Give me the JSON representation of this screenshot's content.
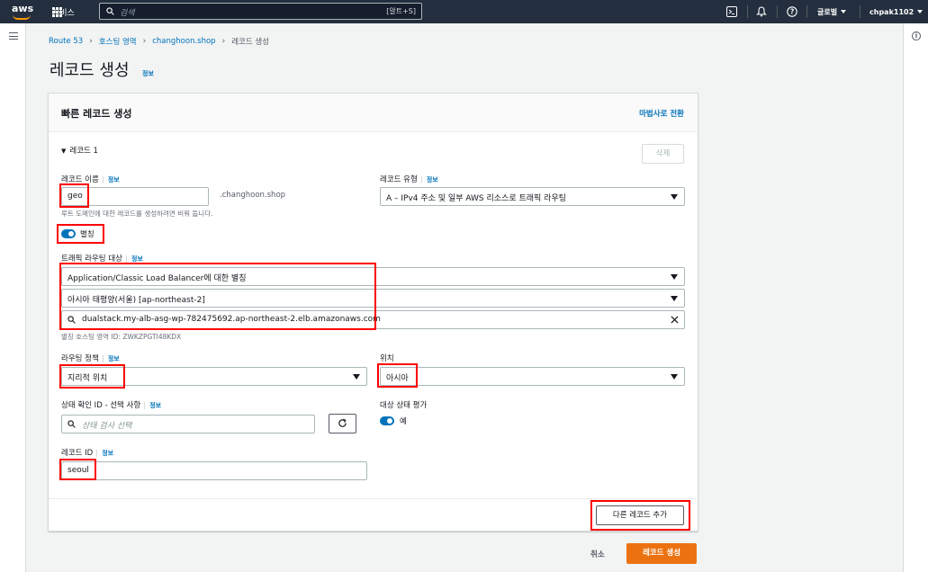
{
  "topnav": {
    "logo": "aws",
    "services_label": "서비스",
    "search_placeholder": "검색",
    "search_shortcut": "[알트+S]",
    "region": "글로벌",
    "account": "chpak1102"
  },
  "breadcrumb": {
    "items": [
      "Route 53",
      "호스팅 영역",
      "changhoon.shop"
    ],
    "current": "레코드 생성"
  },
  "page": {
    "title": "레코드 생성",
    "info": "정보"
  },
  "form": {
    "header_title": "빠른 레코드 생성",
    "wizard_link": "마법사로 전환",
    "record_section": "레코드 1",
    "delete_label": "삭제",
    "record_name": {
      "label": "레코드 이름",
      "info": "정보",
      "value": "geo",
      "suffix": ".changhoon.shop",
      "hint": "루트 도메인에 대한 레코드를 생성하려면 비워 둡니다."
    },
    "record_type": {
      "label": "레코드 유형",
      "info": "정보",
      "value": "A – IPv4 주소 및 일부 AWS 리소스로 트래픽 라우팅"
    },
    "alias": {
      "label": "별칭",
      "enabled": true
    },
    "traffic_target": {
      "label": "트래픽 라우팅 대상",
      "info": "정보",
      "endpoint": "Application/Classic Load Balancer에 대한 별칭",
      "region": "아시아 태평양(서울) [ap-northeast-2]",
      "lb": "dualstack.my-alb-asg-wp-782475692.ap-northeast-2.elb.amazonaws.com",
      "hosted_zone_hint": "별칭 호스팅 영역 ID: ZWKZPGTI48KDX"
    },
    "routing_policy": {
      "label": "라우팅 정책",
      "info": "정보",
      "value": "지리적 위치"
    },
    "location": {
      "label": "위치",
      "value": "아시아"
    },
    "health_check": {
      "label": "상태 확인 ID - 선택 사항",
      "info": "정보",
      "placeholder": "상태 검사 선택"
    },
    "evaluate_health": {
      "label": "대상 상태 평가",
      "value_label": "예",
      "enabled": true
    },
    "record_id": {
      "label": "레코드 ID",
      "info": "정보",
      "value": "seoul"
    },
    "add_record_label": "다른 레코드 추가"
  },
  "footer": {
    "cancel_label": "취소",
    "create_label": "레코드 생성"
  },
  "colors": {
    "nav_bg": "#232f3e",
    "link": "#0073bb",
    "primary": "#ec7211",
    "highlight": "#ff0000"
  }
}
